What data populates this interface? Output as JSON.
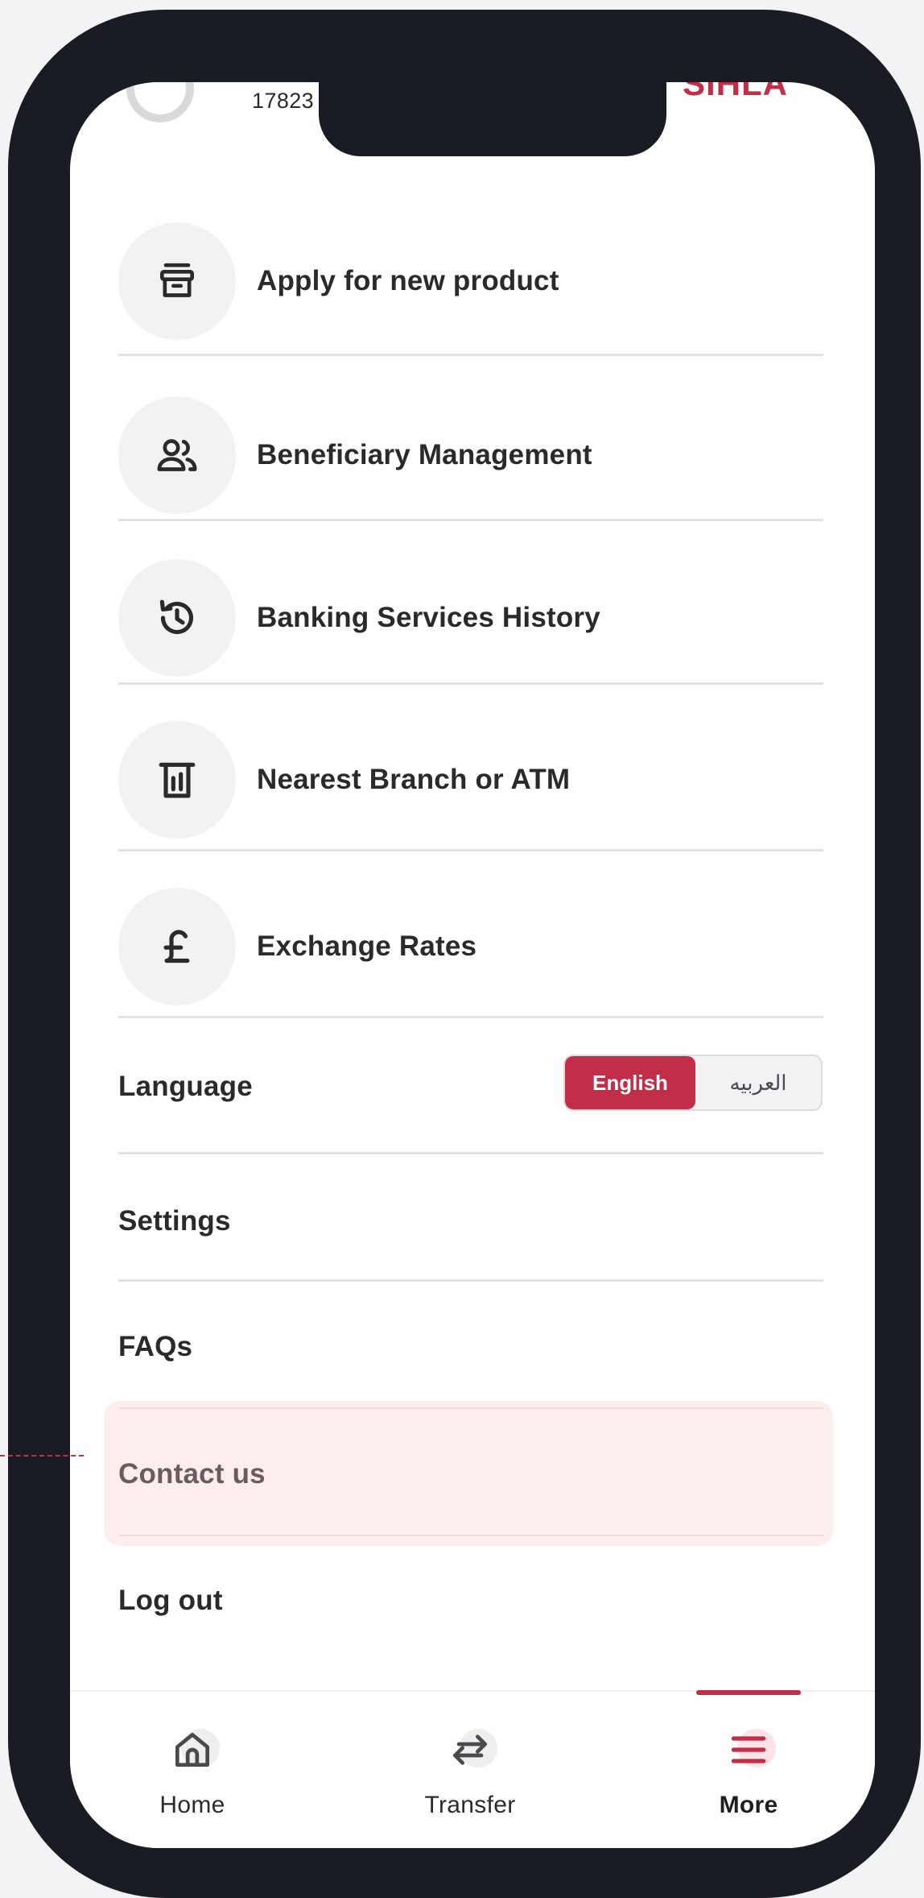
{
  "header": {
    "account_partial": "17823",
    "brand_partial": "SIHLA"
  },
  "menu": {
    "items": [
      {
        "label": "Apply for new product",
        "icon": "product-box-icon"
      },
      {
        "label": "Beneficiary Management",
        "icon": "people-icon"
      },
      {
        "label": "Banking Services History",
        "icon": "history-icon"
      },
      {
        "label": "Nearest Branch or ATM",
        "icon": "atm-icon"
      },
      {
        "label": "Exchange Rates",
        "icon": "pound-icon"
      }
    ],
    "language": {
      "label": "Language",
      "options": [
        "English",
        "العربيه"
      ],
      "selected": "English"
    },
    "settings": "Settings",
    "faqs": "FAQs",
    "contact": "Contact us",
    "logout": "Log out"
  },
  "bottom_nav": {
    "items": [
      {
        "label": "Home",
        "icon": "home-icon"
      },
      {
        "label": "Transfer",
        "icon": "transfer-icon"
      },
      {
        "label": "More",
        "icon": "menu-icon"
      }
    ],
    "active": "More"
  },
  "colors": {
    "accent": "#c22d48",
    "highlight": "#fdeeee",
    "frame": "#1a1c23"
  }
}
